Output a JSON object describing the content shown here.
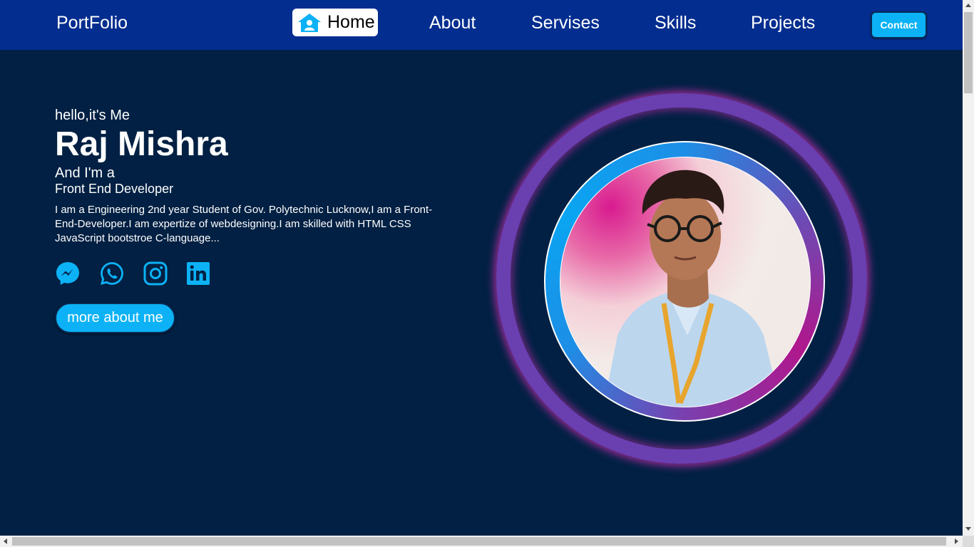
{
  "nav": {
    "brand": "PortFolio",
    "items": [
      {
        "label": "Home",
        "icon": "home-user-icon",
        "active": true
      },
      {
        "label": "About"
      },
      {
        "label": "Servises"
      },
      {
        "label": "Skills"
      },
      {
        "label": "Projects"
      }
    ],
    "contact_label": "Contact"
  },
  "hero": {
    "greeting": "hello,it's Me",
    "name": "Raj Mishra",
    "intro": "And I'm a",
    "role": "Front End Developer",
    "description": "I am a Engineering 2nd year Student of Gov. Polytechnic Lucknow,I am a Front-End-Developer.I am expertize of webdesigning.I am skilled with HTML CSS JavaScript bootstroe C-language...",
    "social": [
      {
        "icon": "messenger-icon"
      },
      {
        "icon": "whatsapp-icon"
      },
      {
        "icon": "instagram-icon"
      },
      {
        "icon": "linkedin-icon"
      }
    ],
    "cta_label": "more about me"
  },
  "colors": {
    "background": "#012043",
    "navbar": "#032d8f",
    "accent": "#0cb2f5",
    "ring_glow": "#c32daa"
  }
}
